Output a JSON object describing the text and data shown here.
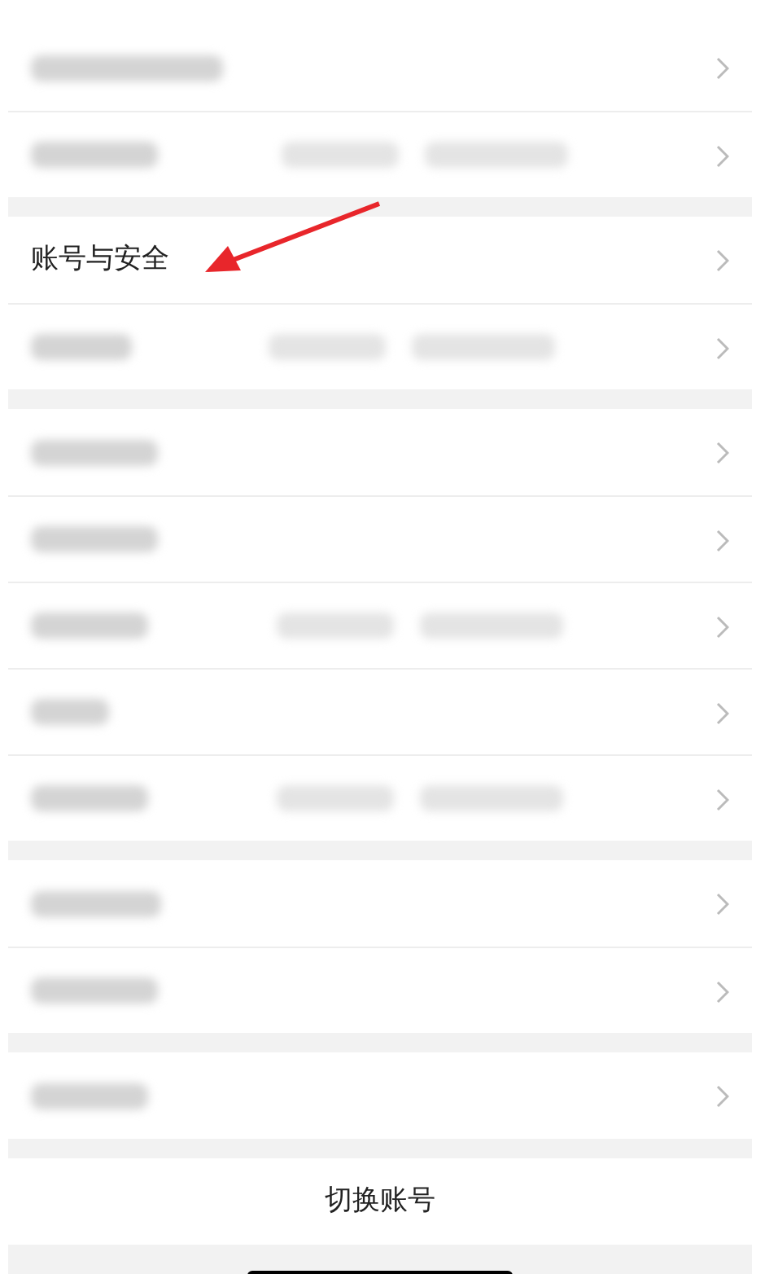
{
  "sections": [
    {
      "rows": [
        {
          "kind": "blurred"
        },
        {
          "kind": "blurred-detail"
        }
      ]
    },
    {
      "rows": [
        {
          "kind": "text",
          "label": "账号与安全"
        },
        {
          "kind": "blurred-detail"
        }
      ]
    },
    {
      "rows": [
        {
          "kind": "blurred"
        },
        {
          "kind": "blurred"
        },
        {
          "kind": "blurred-detail"
        },
        {
          "kind": "blurred"
        },
        {
          "kind": "blurred-detail"
        }
      ]
    },
    {
      "rows": [
        {
          "kind": "blurred"
        },
        {
          "kind": "blurred"
        }
      ]
    },
    {
      "rows": [
        {
          "kind": "blurred"
        }
      ]
    }
  ],
  "switch_account_button": {
    "label": "切换账号"
  }
}
